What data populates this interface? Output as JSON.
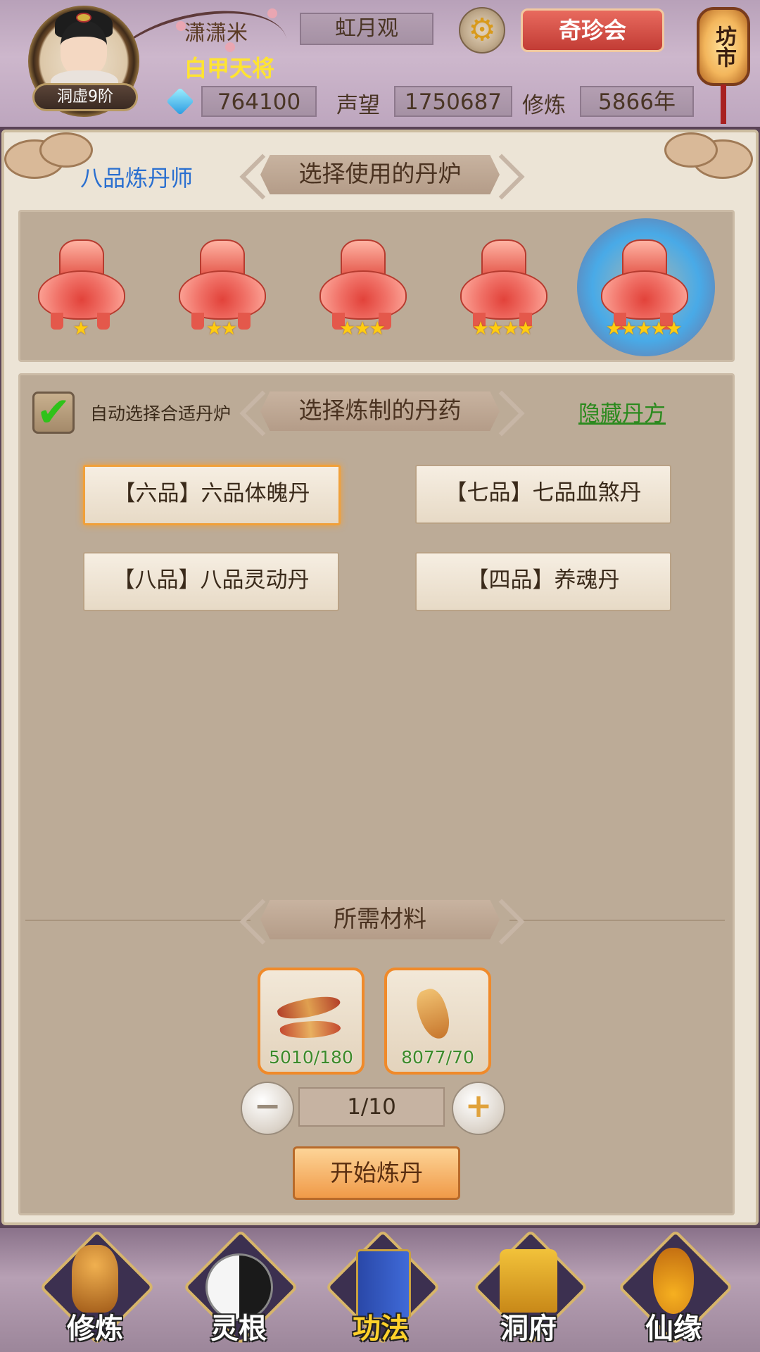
{
  "player": {
    "name": "潇潇米",
    "title": "白甲天将",
    "rank": "洞虚9阶",
    "location": "虹月观"
  },
  "header": {
    "treasure_button": "奇珍会",
    "market": "坊市"
  },
  "stats": {
    "gems": "764100",
    "prestige_label": "声望",
    "prestige": "1750687",
    "cultivation_label": "修炼",
    "cultivation": "5866年"
  },
  "alchemy": {
    "alchemist_rank": "八品炼丹师",
    "furnace_heading": "选择使用的丹炉",
    "furnaces": [
      {
        "stars": 1,
        "selected": false
      },
      {
        "stars": 2,
        "selected": false
      },
      {
        "stars": 3,
        "selected": false
      },
      {
        "stars": 4,
        "selected": false
      },
      {
        "stars": 5,
        "selected": true
      }
    ],
    "auto_select_label": "自动选择合适丹炉",
    "auto_select_checked": true,
    "recipe_heading": "选择炼制的丹药",
    "hide_recipe_link": "隐藏丹方",
    "recipes": [
      {
        "label": "【六品】六品体魄丹",
        "selected": true
      },
      {
        "label": "【七品】七品血煞丹",
        "selected": false
      },
      {
        "label": "【八品】八品灵动丹",
        "selected": false
      },
      {
        "label": "【四品】养魂丹",
        "selected": false
      }
    ],
    "materials_heading": "所需材料",
    "materials": [
      {
        "icon": "cordyceps-icon",
        "count": "5010/180"
      },
      {
        "icon": "ginseng-icon",
        "count": "8077/70"
      }
    ],
    "quantity": "1/10",
    "start_button": "开始炼丹"
  },
  "nav": {
    "items": [
      {
        "label": "修炼",
        "icon": "meditating-monk-icon",
        "active": false
      },
      {
        "label": "灵根",
        "icon": "yin-yang-sword-icon",
        "active": false
      },
      {
        "label": "功法",
        "icon": "scripture-book-icon",
        "active": true
      },
      {
        "label": "洞府",
        "icon": "pagoda-icon",
        "active": false
      },
      {
        "label": "仙缘",
        "icon": "gourd-icon",
        "active": false
      }
    ]
  },
  "colors": {
    "accent_orange": "#f08a2a",
    "link_green": "#2b8a1e",
    "title_yellow": "#ffe431",
    "rank_blue": "#2a6fd0"
  }
}
